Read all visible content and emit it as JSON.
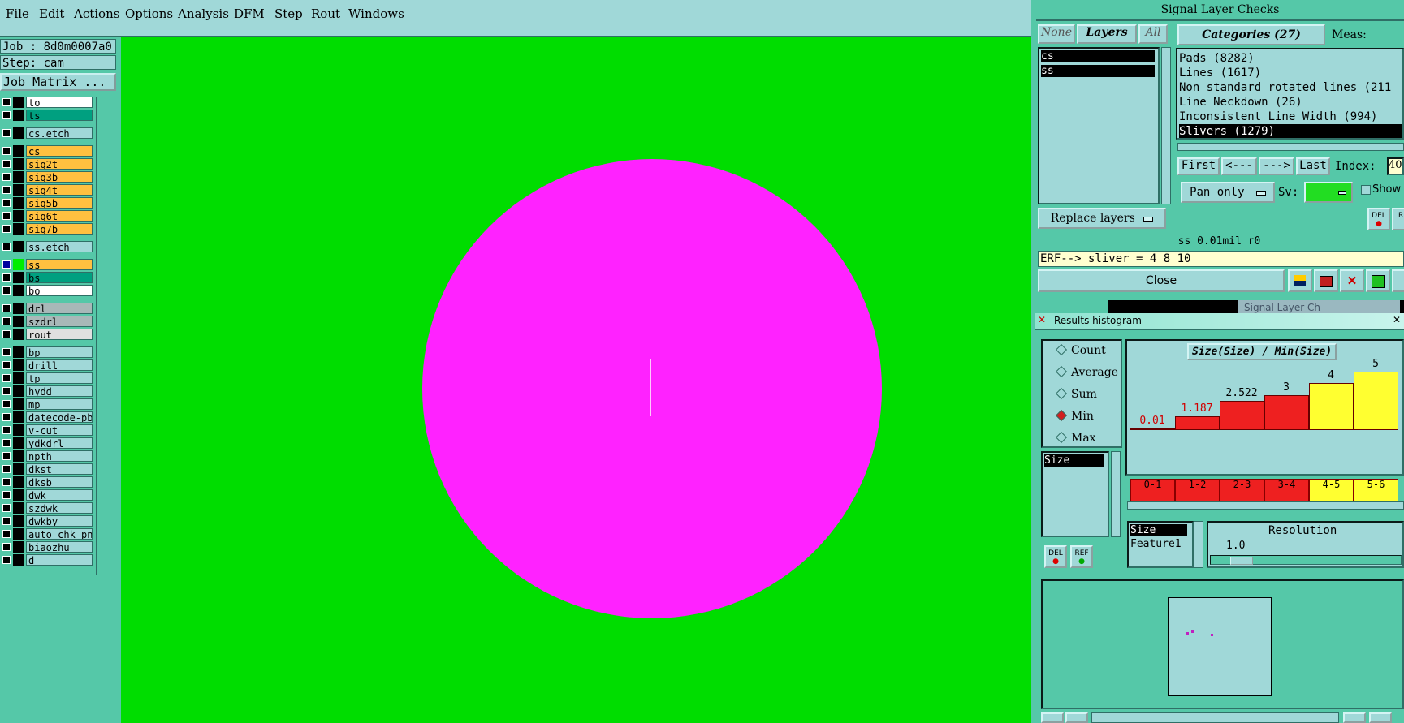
{
  "menu": [
    "File",
    "Edit",
    "Actions",
    "Options",
    "Analysis",
    "DFM",
    "Step",
    "Rout",
    "Windows"
  ],
  "job": {
    "job_label": "Job : 8d0m0007a0",
    "step_label": "Step: cam",
    "matrix_button": "Job Matrix ..."
  },
  "layers": [
    {
      "name": "to",
      "color": "#ffffff",
      "bg": "#ffffff"
    },
    {
      "name": "ts",
      "color": "#00a080",
      "bg": "#00a080"
    },
    {
      "name": "cs.etch",
      "color": "#a0d8d8",
      "bg": "#a0d8d8"
    },
    {
      "name": "cs",
      "color": "#ffc040",
      "bg": "#ffc040"
    },
    {
      "name": "sig2t",
      "color": "#ffc040",
      "bg": "#ffc040"
    },
    {
      "name": "sig3b",
      "color": "#ffc040",
      "bg": "#ffc040"
    },
    {
      "name": "sig4t",
      "color": "#ffc040",
      "bg": "#ffc040"
    },
    {
      "name": "sig5b",
      "color": "#ffc040",
      "bg": "#ffc040"
    },
    {
      "name": "sig6t",
      "color": "#ffc040",
      "bg": "#ffc040"
    },
    {
      "name": "sig7b",
      "color": "#ffc040",
      "bg": "#ffc040"
    },
    {
      "name": "ss.etch",
      "color": "#a0d8d8",
      "bg": "#a0d8d8"
    },
    {
      "name": "ss",
      "color": "#00ee00",
      "bg": "#ffc040"
    },
    {
      "name": "bs",
      "color": "#00a080",
      "bg": "#00a080"
    },
    {
      "name": "bo",
      "color": "#ffffff",
      "bg": "#ffffff"
    },
    {
      "name": "drl",
      "color": "#a8b8b8",
      "bg": "#a8b8b8"
    },
    {
      "name": "szdrl",
      "color": "#a8b8b8",
      "bg": "#a8b8b8"
    },
    {
      "name": "rout",
      "color": "#e0e0e0",
      "bg": "#e0e0e0"
    },
    {
      "name": "bp",
      "color": "#a0d8d8",
      "bg": "#a0d8d8"
    },
    {
      "name": "drill",
      "color": "#a0d8d8",
      "bg": "#a0d8d8"
    },
    {
      "name": "tp",
      "color": "#a0d8d8",
      "bg": "#a0d8d8"
    },
    {
      "name": "hydd",
      "color": "#a0d8d8",
      "bg": "#a0d8d8"
    },
    {
      "name": "mp",
      "color": "#a0d8d8",
      "bg": "#a0d8d8"
    },
    {
      "name": "datecode-pbe",
      "color": "#a0d8d8",
      "bg": "#a0d8d8"
    },
    {
      "name": "v-cut",
      "color": "#a0d8d8",
      "bg": "#a0d8d8"
    },
    {
      "name": "ydkdrl",
      "color": "#a0d8d8",
      "bg": "#a0d8d8"
    },
    {
      "name": "npth",
      "color": "#a0d8d8",
      "bg": "#a0d8d8"
    },
    {
      "name": "dkst",
      "color": "#a0d8d8",
      "bg": "#a0d8d8"
    },
    {
      "name": "dksb",
      "color": "#a0d8d8",
      "bg": "#a0d8d8"
    },
    {
      "name": "dwk",
      "color": "#a0d8d8",
      "bg": "#a0d8d8"
    },
    {
      "name": "szdwk",
      "color": "#a0d8d8",
      "bg": "#a0d8d8"
    },
    {
      "name": "dwkby",
      "color": "#a0d8d8",
      "bg": "#a0d8d8"
    },
    {
      "name": "auto_chk_pnl",
      "color": "#a0d8d8",
      "bg": "#a0d8d8"
    },
    {
      "name": "biaozhu",
      "color": "#a0d8d8",
      "bg": "#a0d8d8"
    },
    {
      "name": "d",
      "color": "#a0d8d8",
      "bg": "#a0d8d8"
    }
  ],
  "signal_checks": {
    "title": "Signal Layer Checks",
    "none_btn": "None",
    "layers_btn": "Layers",
    "all_btn": "All",
    "layer_items": [
      "cs",
      "ss"
    ],
    "categories_btn": "Categories (27)",
    "meas_label": "Meas:",
    "categories": [
      "Pads (8282)",
      "Lines (1617)",
      "Non standard rotated lines (211",
      "Line Neckdown (26)",
      "Inconsistent Line Width (994)",
      "Slivers (1279)"
    ],
    "first_btn": "First",
    "prev_btn": "<---",
    "next_btn": "--->",
    "last_btn": "Last",
    "index_label": "Index:",
    "index_value": "40",
    "pan_only": "Pan only",
    "sv_label": "Sv:",
    "show_label": "Show",
    "replace_layers": "Replace layers",
    "status": "ss 0.01mil  r0",
    "erf": "ERF--> sliver = 4 8 10",
    "close_btn": "Close",
    "del_label": "DEL",
    "ref_label": "RE"
  },
  "histogram": {
    "title": "Results histogram",
    "modes": [
      "Count",
      "Average",
      "Sum",
      "Min",
      "Max"
    ],
    "selected_mode": "Min",
    "field_items": [
      "Size"
    ],
    "chart_title": "Size(Size) / Min(Size)",
    "bins": [
      "0-1",
      "1-2",
      "2-3",
      "3-4",
      "4-5",
      "5-6"
    ],
    "value_labels": [
      "0.01",
      "1.187",
      "2.522",
      "3",
      "4",
      "5"
    ],
    "values": [
      0.01,
      1.187,
      2.522,
      3,
      4,
      5
    ],
    "bar_colors": [
      "#ee2020",
      "#ee2020",
      "#ee2020",
      "#ee2020",
      "#ffff30",
      "#ffff30"
    ],
    "sort_items": [
      "Size",
      "Feature1"
    ],
    "resolution_label": "Resolution",
    "resolution_value": "1.0",
    "del_label": "DEL",
    "ref_label": "REF"
  },
  "taskbar_ghost": "Signal Layer Ch"
}
